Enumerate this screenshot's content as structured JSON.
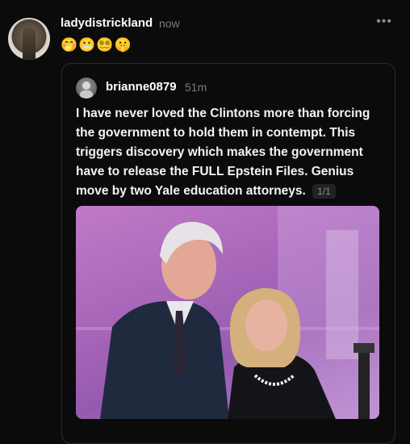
{
  "post": {
    "username": "ladydistrickland",
    "time": "now",
    "more_icon": "more-horizontal-icon",
    "emojis": "🤭😬😵‍💫🤫"
  },
  "quoted_post": {
    "username": "brianne0879",
    "time": "51m",
    "text": "I have never loved the Clintons more than forcing the government to hold them in contempt. This triggers discovery which makes the government have to release the FULL Epstein Files. Genius move by two Yale education attorneys.",
    "media_counter": "1/1"
  },
  "colors": {
    "background": "#0b0b0b",
    "secondary_text": "#7c7c7c",
    "photo_backdrop": "#b070c0"
  }
}
